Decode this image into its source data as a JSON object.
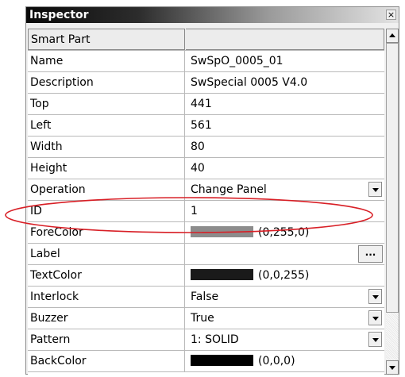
{
  "window": {
    "title": "Inspector",
    "close_glyph": "×"
  },
  "header": {
    "label": "Smart Part",
    "value": ""
  },
  "properties": [
    {
      "name": "Name",
      "value": "SwSpO_0005_01"
    },
    {
      "name": "Description",
      "value": "SwSpecial 0005  V4.0"
    },
    {
      "name": "Top",
      "value": "441"
    },
    {
      "name": "Left",
      "value": "561"
    },
    {
      "name": "Width",
      "value": "80"
    },
    {
      "name": "Height",
      "value": "40"
    },
    {
      "name": "Operation",
      "value": "Change Panel"
    },
    {
      "name": "ID",
      "value": "1"
    },
    {
      "name": "ForeColor",
      "value": "(0,255,0)",
      "swatch_color": "#8c8c8c"
    },
    {
      "name": "Label",
      "value": "",
      "ellipsis": "..."
    },
    {
      "name": "TextColor",
      "value": "(0,0,255)",
      "swatch_color": "#1a1a1a"
    },
    {
      "name": "Interlock",
      "value": "False"
    },
    {
      "name": "Buzzer",
      "value": "True"
    },
    {
      "name": "Pattern",
      "value": "1: SOLID"
    },
    {
      "name": "BackColor",
      "value": "(0,0,0)",
      "swatch_color": "#000000"
    }
  ],
  "annotation": {
    "ellipse_color": "#d81f26",
    "highlighted_property": "ID"
  }
}
